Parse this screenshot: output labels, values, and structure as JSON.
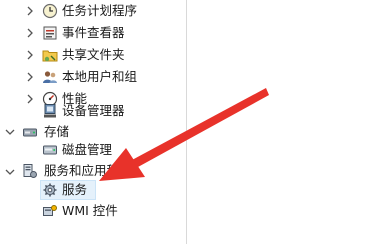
{
  "tree": {
    "items": [
      {
        "label": "任务计划程序",
        "icon": "clock-icon",
        "expander": "right"
      },
      {
        "label": "事件查看器",
        "icon": "event-viewer-icon",
        "expander": "right"
      },
      {
        "label": "共享文件夹",
        "icon": "shared-folder-icon",
        "expander": "right"
      },
      {
        "label": "本地用户和组",
        "icon": "users-icon",
        "expander": "right"
      },
      {
        "label": "性能",
        "icon": "performance-icon",
        "expander": "right"
      },
      {
        "label": "设备管理器",
        "icon": "device-manager-icon",
        "expander": "none"
      },
      {
        "label": "存储",
        "icon": "storage-icon",
        "expander": "down"
      },
      {
        "label": "磁盘管理",
        "icon": "disk-icon",
        "expander": "none"
      },
      {
        "label": "服务和应用程序",
        "icon": "services-apps-icon",
        "expander": "down"
      },
      {
        "label": "服务",
        "icon": "gear-icon",
        "expander": "none",
        "selected": true
      },
      {
        "label": "WMI 控件",
        "icon": "wmi-icon",
        "expander": "none"
      }
    ]
  },
  "annotation": {
    "arrow_color": "#e8322a"
  }
}
